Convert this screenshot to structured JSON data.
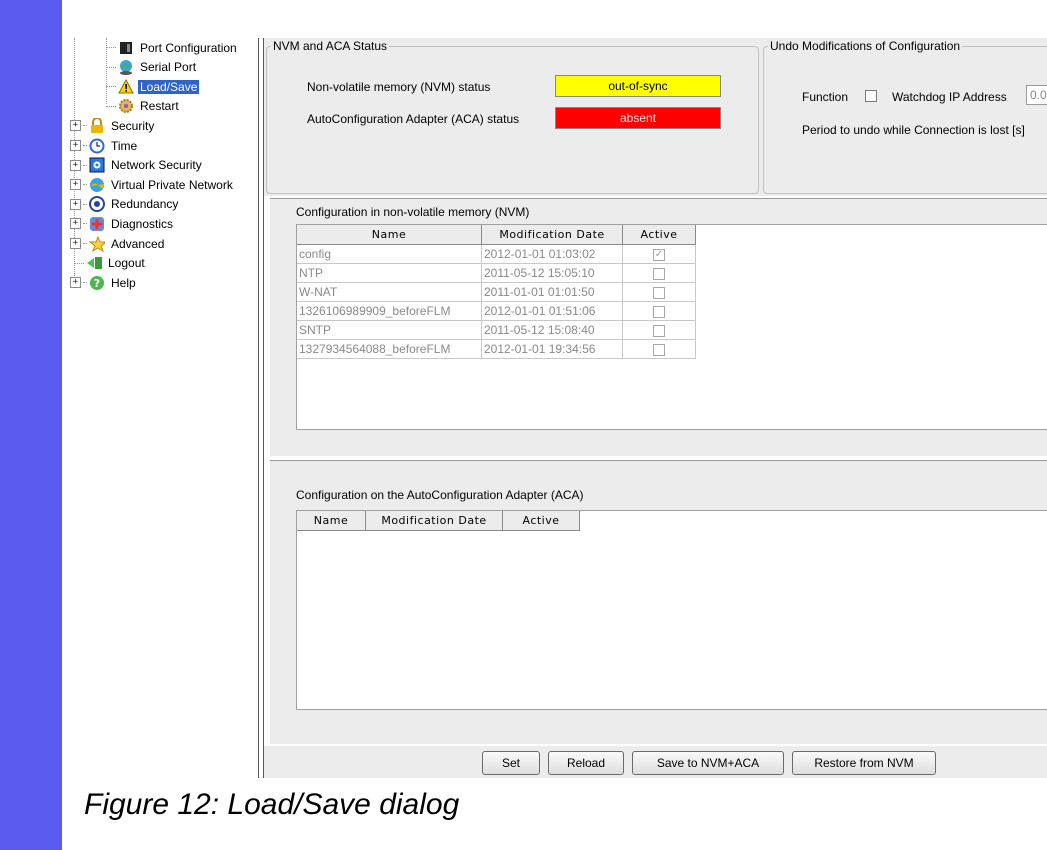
{
  "tree": {
    "items": [
      {
        "label": "Port Configuration",
        "icon": "port-icon",
        "expandable": false,
        "indent": 1,
        "selected": false
      },
      {
        "label": "Serial Port",
        "icon": "globe-icon",
        "expandable": false,
        "indent": 1,
        "selected": false
      },
      {
        "label": "Load/Save",
        "icon": "warning-icon",
        "expandable": false,
        "indent": 1,
        "selected": true
      },
      {
        "label": "Restart",
        "icon": "gear-icon",
        "expandable": false,
        "indent": 1,
        "selected": false
      },
      {
        "label": "Security",
        "icon": "lock-icon",
        "expandable": true,
        "indent": 0,
        "selected": false
      },
      {
        "label": "Time",
        "icon": "clock-icon",
        "expandable": true,
        "indent": 0,
        "selected": false
      },
      {
        "label": "Network Security",
        "icon": "network-icon",
        "expandable": true,
        "indent": 0,
        "selected": false
      },
      {
        "label": "Virtual Private Network",
        "icon": "vpn-icon",
        "expandable": true,
        "indent": 0,
        "selected": false
      },
      {
        "label": "Redundancy",
        "icon": "redundancy-icon",
        "expandable": true,
        "indent": 0,
        "selected": false
      },
      {
        "label": "Diagnostics",
        "icon": "diagnostics-icon",
        "expandable": true,
        "indent": 0,
        "selected": false
      },
      {
        "label": "Advanced",
        "icon": "star-icon",
        "expandable": true,
        "indent": 0,
        "selected": false
      },
      {
        "label": "Logout",
        "icon": "logout-icon",
        "expandable": false,
        "indent": 0,
        "selected": false
      },
      {
        "label": "Help",
        "icon": "help-icon",
        "expandable": true,
        "indent": 0,
        "selected": false
      }
    ]
  },
  "nvm_status": {
    "legend": "NVM and ACA Status",
    "nvm_label": "Non-volatile memory (NVM) status",
    "nvm_value": "out-of-sync",
    "nvm_color": "#ffff00",
    "aca_label": "AutoConfiguration Adapter (ACA) status",
    "aca_value": "absent",
    "aca_color": "#ff0000"
  },
  "undo": {
    "legend": "Undo Modifications of Configuration",
    "function_label": "Function",
    "watchdog_label": "Watchdog IP Address",
    "watchdog_value": "0.0",
    "period_label": "Period to undo while Connection is lost [s]"
  },
  "nvm_table": {
    "title": "Configuration in non-volatile memory (NVM)",
    "columns": [
      "Name",
      "Modification Date",
      "Active"
    ],
    "rows": [
      {
        "name": "config",
        "date": "2012-01-01 01:03:02",
        "active": true
      },
      {
        "name": "NTP",
        "date": "2011-05-12 15:05:10",
        "active": false
      },
      {
        "name": "W-NAT",
        "date": "2011-01-01 01:01:50",
        "active": false
      },
      {
        "name": "1326106989909_beforeFLM",
        "date": "2012-01-01 01:51:06",
        "active": false
      },
      {
        "name": "SNTP",
        "date": "2011-05-12 15:08:40",
        "active": false
      },
      {
        "name": "1327934564088_beforeFLM",
        "date": "2012-01-01 19:34:56",
        "active": false
      }
    ]
  },
  "aca_table": {
    "title": "Configuration on the AutoConfiguration Adapter (ACA)",
    "columns": [
      "Name",
      "Modification Date",
      "Active"
    ]
  },
  "buttons": {
    "set": "Set",
    "reload": "Reload",
    "save": "Save to NVM+ACA",
    "restore": "Restore from NVM"
  },
  "caption": "Figure 12: Load/Save dialog"
}
